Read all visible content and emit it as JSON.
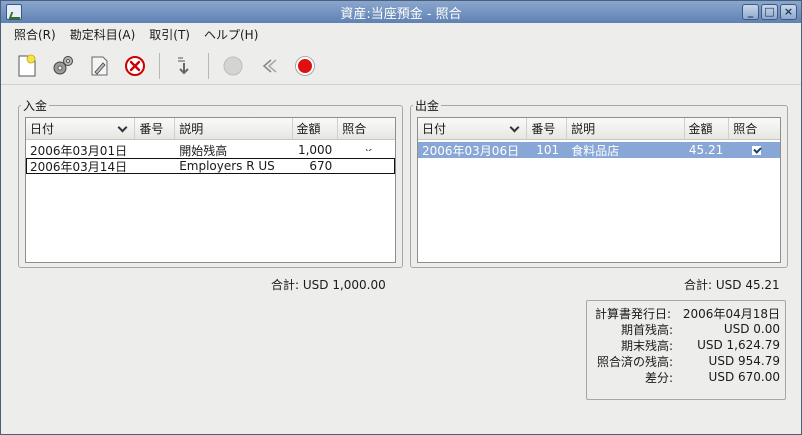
{
  "window": {
    "title": "資産:当座預金 - 照合",
    "buttons": {
      "minimize": "_",
      "maximize": "□",
      "close": "×"
    }
  },
  "menu": [
    {
      "label": "照合(R)"
    },
    {
      "label": "勘定科目(A)"
    },
    {
      "label": "取引(T)"
    },
    {
      "label": "ヘルプ(H)"
    }
  ],
  "toolbar": {
    "icons": [
      "new-document-icon",
      "gears-icon",
      "edit-document-icon",
      "delete-circle-icon",
      "balance-down-icon",
      "circle-disabled-icon",
      "back-arrow-icon",
      "record-stop-icon"
    ]
  },
  "deposits": {
    "label": "入金",
    "columns": {
      "date": "日付",
      "num": "番号",
      "desc": "説明",
      "amount": "金額",
      "reconciled": "照合"
    },
    "rows": [
      {
        "date": "2006年03月01日",
        "num": "",
        "desc": "開始残高",
        "amount": "1,000",
        "reconciled": true
      },
      {
        "date": "2006年03月14日",
        "num": "",
        "desc": "Employers R US",
        "amount": "670",
        "reconciled": false
      }
    ],
    "total_label": "合計:",
    "total_value": "USD 1,000.00"
  },
  "withdrawals": {
    "label": "出金",
    "columns": {
      "date": "日付",
      "num": "番号",
      "desc": "説明",
      "amount": "金額",
      "reconciled": "照合"
    },
    "rows": [
      {
        "date": "2006年03月06日",
        "num": "101",
        "desc": "食料品店",
        "amount": "45.21",
        "reconciled": true
      }
    ],
    "total_label": "合計:",
    "total_value": "USD 45.21"
  },
  "summary": {
    "statement_date_label": "計算書発行日:",
    "statement_date": "2006年04月18日",
    "starting_balance_label": "期首残高:",
    "starting_balance": "USD 0.00",
    "ending_balance_label": "期末残高:",
    "ending_balance": "USD 1,624.79",
    "reconciled_balance_label": "照合済の残高:",
    "reconciled_balance": "USD 954.79",
    "difference_label": "差分:",
    "difference": "USD 670.00"
  }
}
